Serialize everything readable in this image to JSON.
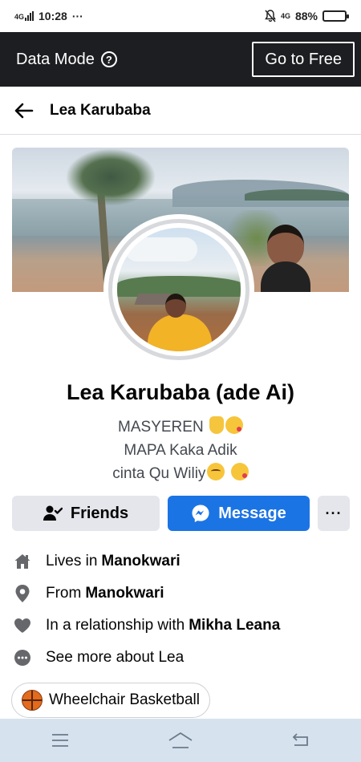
{
  "status_bar": {
    "network_label": "4G",
    "time": "10:28",
    "dots": "···",
    "right_network_label": "4G",
    "battery_percent": "88%",
    "battery_level": 0.88
  },
  "data_mode_bar": {
    "label": "Data Mode",
    "help_icon": "?",
    "go_to_free_label": "Go to Free"
  },
  "header": {
    "title": "Lea Karubaba"
  },
  "profile": {
    "name": "Lea Karubaba (ade Ai)",
    "bio_lines": [
      "MASYEREN",
      "MAPA Kaka Adik",
      "cinta Qu Wiliy"
    ],
    "bio_emojis": [
      "folded-hands",
      "face-blowing-kiss",
      "relieved-face"
    ]
  },
  "actions": {
    "friends_label": "Friends",
    "message_label": "Message",
    "more_label": "···"
  },
  "intro": [
    {
      "icon": "home-icon",
      "prefix": "Lives in",
      "value": "Manokwari"
    },
    {
      "icon": "location-pin-icon",
      "prefix": "From",
      "value": "Manokwari"
    },
    {
      "icon": "heart-icon",
      "prefix": "In a relationship with",
      "value": "Mikha Leana"
    },
    {
      "icon": "more-circle-icon",
      "prefix": "See more about Lea",
      "value": ""
    }
  ],
  "hobby": {
    "icon": "basketball-icon",
    "label": "Wheelchair Basketball"
  },
  "nav_bar": {
    "items": [
      "menu-icon",
      "home-outline-icon",
      "back-icon"
    ]
  },
  "colors": {
    "data_bar": "#1c1e21",
    "message_button": "#1b74e4",
    "secondary_button": "#e4e6eb",
    "nav_bar": "#d6e3ef"
  }
}
